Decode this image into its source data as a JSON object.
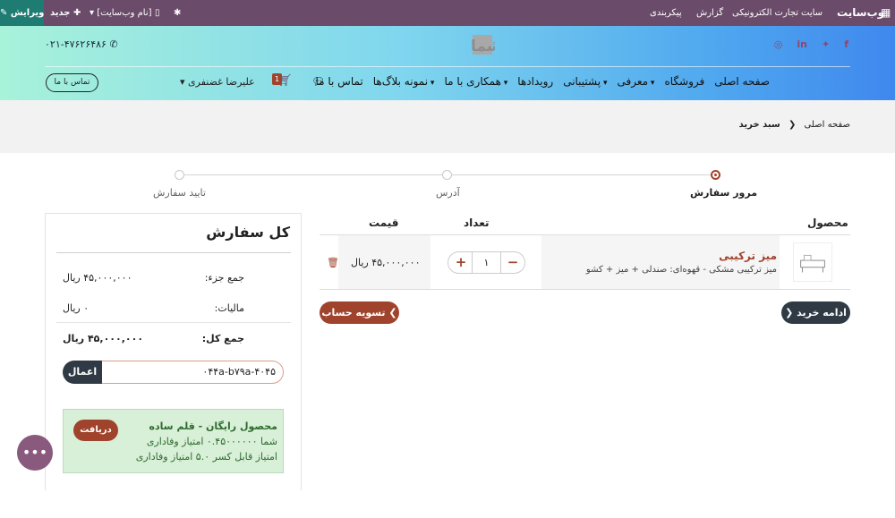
{
  "adminbar": {
    "edit_label": "ویرایش",
    "new_label": "جدید",
    "site_name": "[نام وب‌سایت]",
    "settings": "پیکربندی",
    "reports": "گزارش",
    "ecommerce": "تجارت الکترونیکی",
    "site": "سایت",
    "website": "وب‌سایت"
  },
  "header": {
    "phone": "۰۲۱-۴۷۶۲۶۴۸۶",
    "logo_text": "لوگو شما",
    "contact_button": "تماس با ما",
    "cart_count": "1",
    "user_name": "علیرضا غضنفری",
    "nav": [
      {
        "label": "صفحه اصلی",
        "dropdown": false
      },
      {
        "label": "فروشگاه",
        "dropdown": false
      },
      {
        "label": "معرفی",
        "dropdown": true
      },
      {
        "label": "پشتیبانی",
        "dropdown": true
      },
      {
        "label": "رویدادها",
        "dropdown": false
      },
      {
        "label": "همکاری با ما",
        "dropdown": true
      },
      {
        "label": "نمونه بلاگ‌ها",
        "dropdown": true
      },
      {
        "label": "تماس با ما",
        "dropdown": false
      }
    ]
  },
  "breadcrumb": {
    "home": "صفحه اصلی",
    "current": "سبد خرید"
  },
  "steps": {
    "review": "مرور سفارش",
    "address": "آدرس",
    "confirm": "تایید سفارش"
  },
  "table": {
    "col_product": "محصول",
    "col_qty": "تعداد",
    "col_price": "قیمت",
    "row": {
      "name": "میز ترکیبی",
      "description": "میز ترکیبی مشکی - قهوه‌ای: صندلی + میز + کشو",
      "quantity": "۱",
      "price": "۴۵,۰۰۰,۰۰۰ ریال"
    }
  },
  "buttons": {
    "checkout": "تسویه حساب",
    "continue": "ادامه خرید"
  },
  "summary": {
    "title": "کل سفارش",
    "subtotal_label": "جمع جزء:",
    "subtotal_value": "۴۵,۰۰۰,۰۰۰ ریال",
    "tax_label": "مالیات:",
    "tax_value": "۰ ریال",
    "total_label": "جمع کل:",
    "total_value": "۴۵,۰۰۰,۰۰۰ ریال",
    "coupon_value": "۰۴۴a-b۷۹a-۴۰۴۵",
    "apply_label": "اعمال"
  },
  "reward": {
    "title": "محصول رایگان - قلم ساده",
    "points_have": "شما ۰.۴۵۰۰۰۰۰۰ امتیاز وفاداری",
    "points_deductible": "امتیاز قابل کسر ۵.۰ امتیاز وفاداری",
    "claim_label": "دریافت"
  },
  "colors": {
    "accent": "#a0432c",
    "admin_bar": "#6b4b6a",
    "dark_button": "#2f3a44"
  }
}
